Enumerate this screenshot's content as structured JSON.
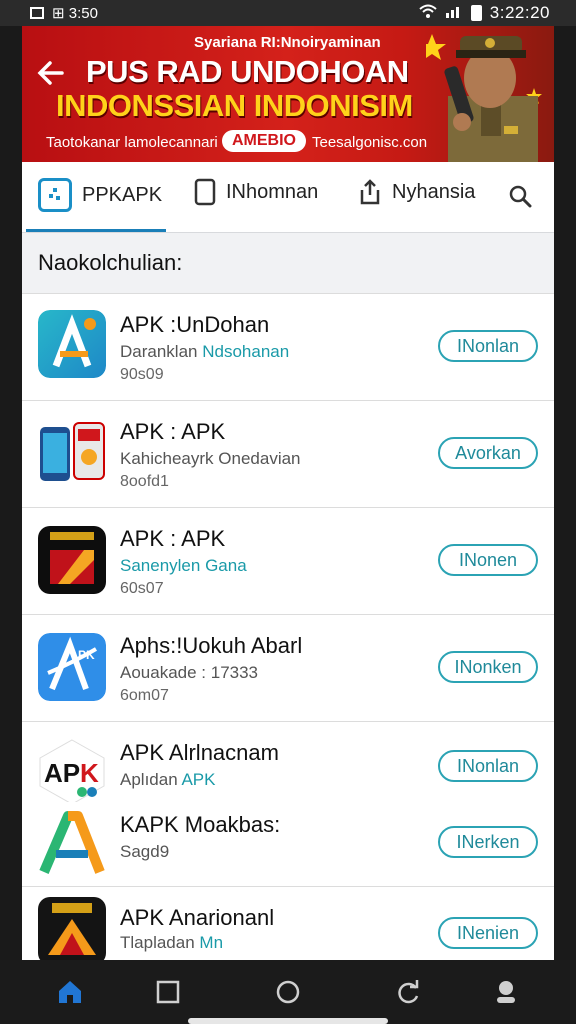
{
  "status": {
    "time": "3:22:20",
    "left_text": "⊞ 3:50"
  },
  "banner": {
    "top_line": "Syariana RI:Nnoiryaminan",
    "headline_1": "PUS RAD UNDOHOAN",
    "headline_2": "INDONSSIAN INDONISIM",
    "footer_text": "Taotokanar lamolecannari",
    "badge": "AMEBIO",
    "site": "Teesalgonisc.con",
    "colors": {
      "red": "#d4211a",
      "yellow": "#ffd21a"
    }
  },
  "tabs": [
    {
      "label": "PPKAPK",
      "icon": "apps-icon",
      "active": true
    },
    {
      "label": "INhomnan",
      "icon": "phone-icon",
      "active": false
    },
    {
      "label": "Nyhansia",
      "icon": "share-icon",
      "active": false
    }
  ],
  "search_icon": "search-icon",
  "section_title": "Naokolchulian:",
  "apps": [
    {
      "name": "APK :UnDohan",
      "desc": "Daranklan",
      "desc_hl": "Ndsohanan",
      "size": "90s09",
      "button": "INonlan",
      "icon": "app-a-teal"
    },
    {
      "name": "APK : APK",
      "desc": "Kahicheayrk Onedavian",
      "desc_hl": "",
      "size": "8oofd1",
      "button": "Avorkan",
      "icon": "app-phones"
    },
    {
      "name": "APK : APK",
      "desc": "",
      "desc_hl": "Sanenylen Gana",
      "size": "60s07",
      "button": "INonen",
      "icon": "app-red-black"
    },
    {
      "name": "Aphs:!Uokuh Abarl",
      "desc": "Aouakade : 17333",
      "desc_hl": "",
      "size": "6om07",
      "button": "INonken",
      "icon": "app-blue-a"
    },
    {
      "name": "APK Alrlnacnam",
      "desc": "Aplıdan",
      "desc_hl": "APK",
      "size": "",
      "button": "INonlan",
      "icon": "app-apk-logo"
    },
    {
      "name": "KAPK Moakbas:",
      "desc": "Sagd9",
      "desc_hl": "",
      "size": "",
      "button": "INerken",
      "icon": "app-a-gradient"
    },
    {
      "name": "APK Anarionanl",
      "desc": "Tlapladan",
      "desc_hl": "Mn",
      "size": "",
      "button": "INenien",
      "icon": "app-gold"
    }
  ],
  "nav": [
    "home-icon",
    "recents-icon",
    "circle-icon",
    "refresh-icon",
    "account-icon"
  ]
}
